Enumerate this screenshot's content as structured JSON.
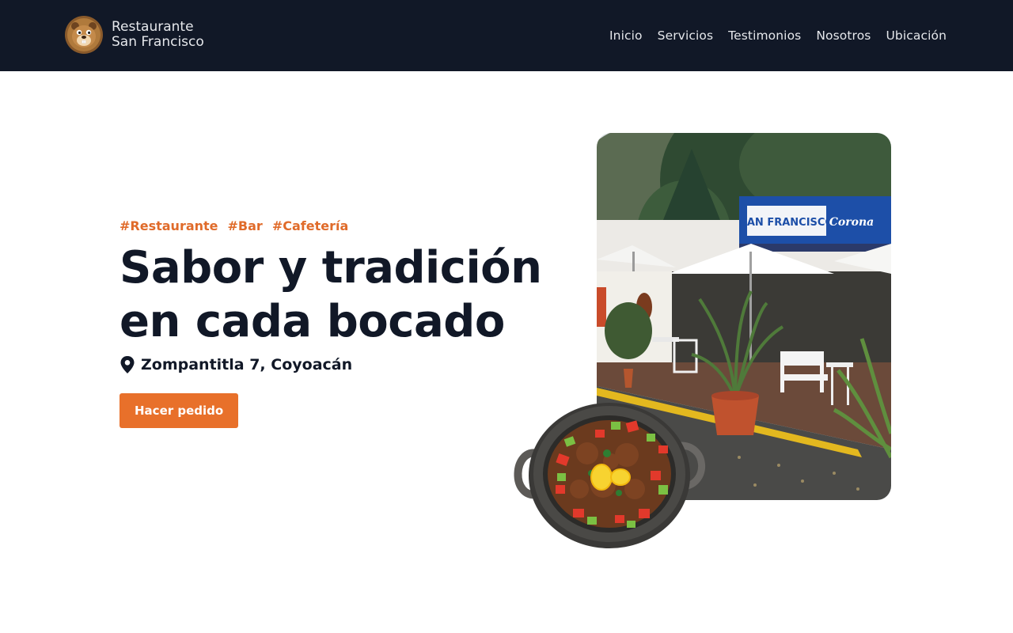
{
  "header": {
    "brand": {
      "line1": "Restaurante",
      "line2": "San Francisco",
      "logo_icon": "beaver-mascot-logo"
    },
    "nav": [
      "Inicio",
      "Servicios",
      "Testimonios",
      "Nosotros",
      "Ubicación"
    ]
  },
  "hero": {
    "tags": [
      "#Restaurante",
      "#Bar",
      "#Cafetería"
    ],
    "headline_line1": "Sabor y tradición",
    "headline_line2": "en cada bocado",
    "address": "Zompantitla 7, Coyoacán",
    "address_icon": "map-pin-icon",
    "cta_label": "Hacer pedido",
    "photo": {
      "sign_text": "SAN FRANCISCO",
      "sign_brand": "Corona"
    }
  },
  "colors": {
    "header_bg": "#111827",
    "accent": "#e8702a",
    "tag": "#e06b2a",
    "text_dark": "#111827"
  }
}
